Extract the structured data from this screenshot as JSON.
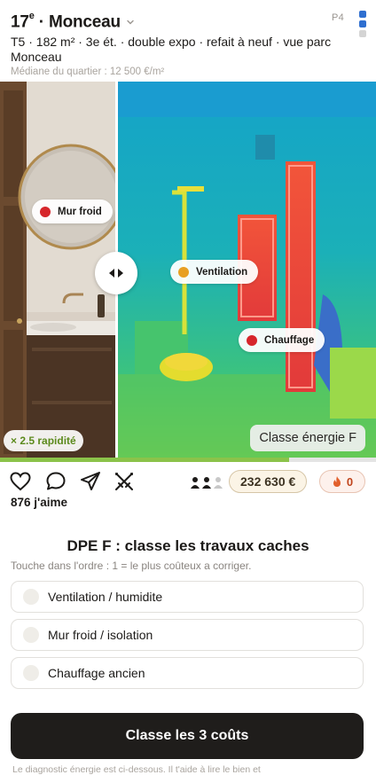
{
  "listing": {
    "title_number": "17",
    "title_sup": "e",
    "title_rest": " · Monceau",
    "code": "P4",
    "subtitle": "T5 · 182 m² · 3e ét. · double expo · refait à neuf · vue parc Monceau",
    "median": "Médiane du quartier : 12 500 €/m²"
  },
  "page_indicator": {
    "colors": [
      "#2f6fd0",
      "#2f6fd0",
      "#d4d4d4"
    ]
  },
  "media": {
    "tags": [
      {
        "label": "Mur froid",
        "dot_color": "#d6262b"
      },
      {
        "label": "Ventilation",
        "dot_color": "#e8a022"
      },
      {
        "label": "Chauffage",
        "dot_color": "#d6262b"
      }
    ],
    "speed_badge": "× 2.5 rapidité",
    "energy_class": "Classe énergie F",
    "progress_fraction": 0.77
  },
  "actions": {
    "price": "232 630 €",
    "fire_count": "0",
    "likes": "876 j'aime",
    "icons": [
      "heart-icon",
      "comment-icon",
      "share-icon",
      "swords-icon"
    ]
  },
  "quiz": {
    "title": "DPE F : classe les travaux caches",
    "hint": "Touche dans l'ordre : 1 = le plus coûteux a corriger.",
    "options": [
      "Ventilation / humidite",
      "Mur froid / isolation",
      "Chauffage ancien"
    ],
    "cta": "Classe les 3 coûts"
  },
  "footnote": "Le diagnostic énergie est ci-dessous. Il t'aide à lire le bien et"
}
